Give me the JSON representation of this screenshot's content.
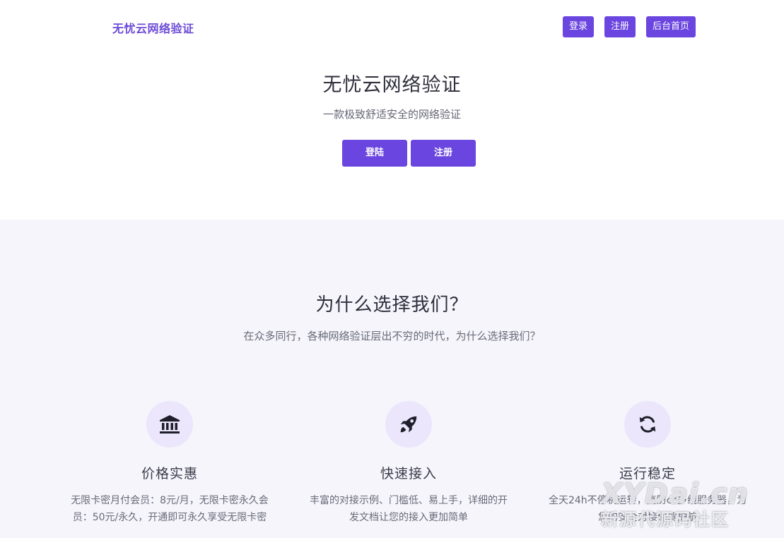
{
  "header": {
    "brand": "无忧云网络验证",
    "nav": {
      "login": "登录",
      "register": "注册",
      "admin": "后台首页"
    }
  },
  "hero": {
    "title": "无忧云网络验证",
    "subtitle": "一款极致舒适安全的网络验证",
    "login_button": "登陆",
    "register_button": "注册"
  },
  "why": {
    "title": "为什么选择我们？",
    "subtitle": "在众多同行，各种网络验证层出不穷的时代，为什么选择我们？",
    "features": [
      {
        "icon": "bank-icon",
        "title": "价格实惠",
        "desc": "无限卡密月付会员：8元/月，无限卡密永久会员：50元/永久，开通即可永久享受无限卡密"
      },
      {
        "icon": "rocket-icon",
        "title": "快速接入",
        "desc": "丰富的对接示例、门槛低、易上手，详细的开发文档让您的接入更加简单"
      },
      {
        "icon": "refresh-icon",
        "title": "运行稳定",
        "desc": "全天24h不停机运转，高防cc多线服务器，为您的安全对接保驾护航"
      }
    ]
  },
  "watermark": {
    "top": "XYDai.cn",
    "bottom": "新源代源码社区"
  },
  "colors": {
    "accent": "#6a45e0",
    "section_bg": "#f5f5fb",
    "icon_bg": "#ebe6fb"
  }
}
